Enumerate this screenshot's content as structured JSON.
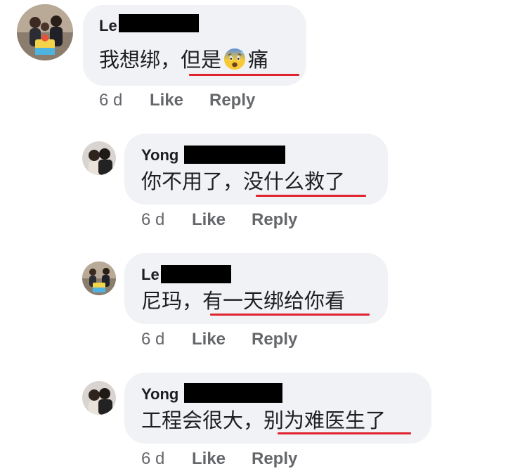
{
  "comments": [
    {
      "author_visible": "Le",
      "text_plain": "我想绑，",
      "text_underlined_a": "但是",
      "emoji": "anxious-face-with-sweat-icon",
      "text_underlined_b": "痛",
      "time": "6 d",
      "like_label": "Like",
      "reply_label": "Reply"
    },
    {
      "author_visible": "Yong",
      "text_plain": "你不用了，",
      "text_underlined": "没什么救了",
      "time": "6 d",
      "like_label": "Like",
      "reply_label": "Reply"
    },
    {
      "author_visible": "Le",
      "text_plain": "尼玛，",
      "text_underlined": "有一天绑给你看",
      "time": "6 d",
      "like_label": "Like",
      "reply_label": "Reply"
    },
    {
      "author_visible": "Yong",
      "text_plain": "工程会很大，",
      "text_underlined": "别为难医生了",
      "time": "6 d",
      "like_label": "Like",
      "reply_label": "Reply"
    }
  ],
  "colors": {
    "bubble": "#f0f2f5",
    "underline": "#e0242f",
    "meta": "#65676b",
    "redaction": "#000000"
  }
}
